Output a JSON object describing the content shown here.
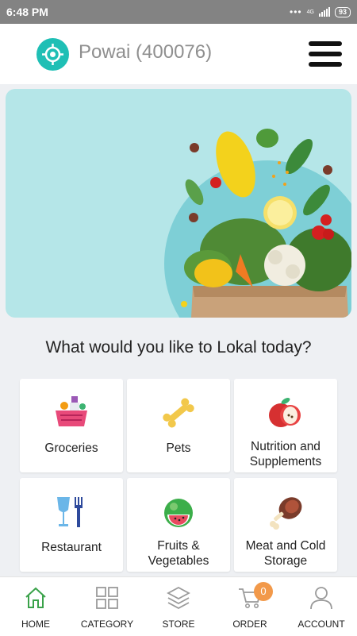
{
  "status_bar": {
    "time": "6:48 PM",
    "network": "4G",
    "battery": "93"
  },
  "header": {
    "location": "Powai (400076)"
  },
  "main": {
    "question": "What would you like to Lokal today?",
    "categories": [
      {
        "label": "Groceries",
        "icon": "grocery-basket-icon"
      },
      {
        "label": "Pets",
        "icon": "bone-icon"
      },
      {
        "label": "Nutrition and Supplements",
        "icon": "apple-icon"
      },
      {
        "label": "Restaurant",
        "icon": "glass-fork-icon"
      },
      {
        "label": "Fruits & Vegetables",
        "icon": "watermelon-icon"
      },
      {
        "label": "Meat and Cold Storage",
        "icon": "meat-leg-icon"
      }
    ]
  },
  "bottom_nav": {
    "items": [
      {
        "label": "HOME",
        "icon": "home-icon"
      },
      {
        "label": "CATEGORY",
        "icon": "grid-icon"
      },
      {
        "label": "STORE",
        "icon": "layers-icon"
      },
      {
        "label": "ORDER",
        "icon": "cart-icon"
      },
      {
        "label": "ACCOUNT",
        "icon": "user-icon"
      }
    ],
    "order_count": "0"
  },
  "colors": {
    "accent": "#1fbfb5",
    "home_active": "#3aa24a",
    "badge": "#f2994a",
    "banner_bg": "#b5e6e8"
  }
}
